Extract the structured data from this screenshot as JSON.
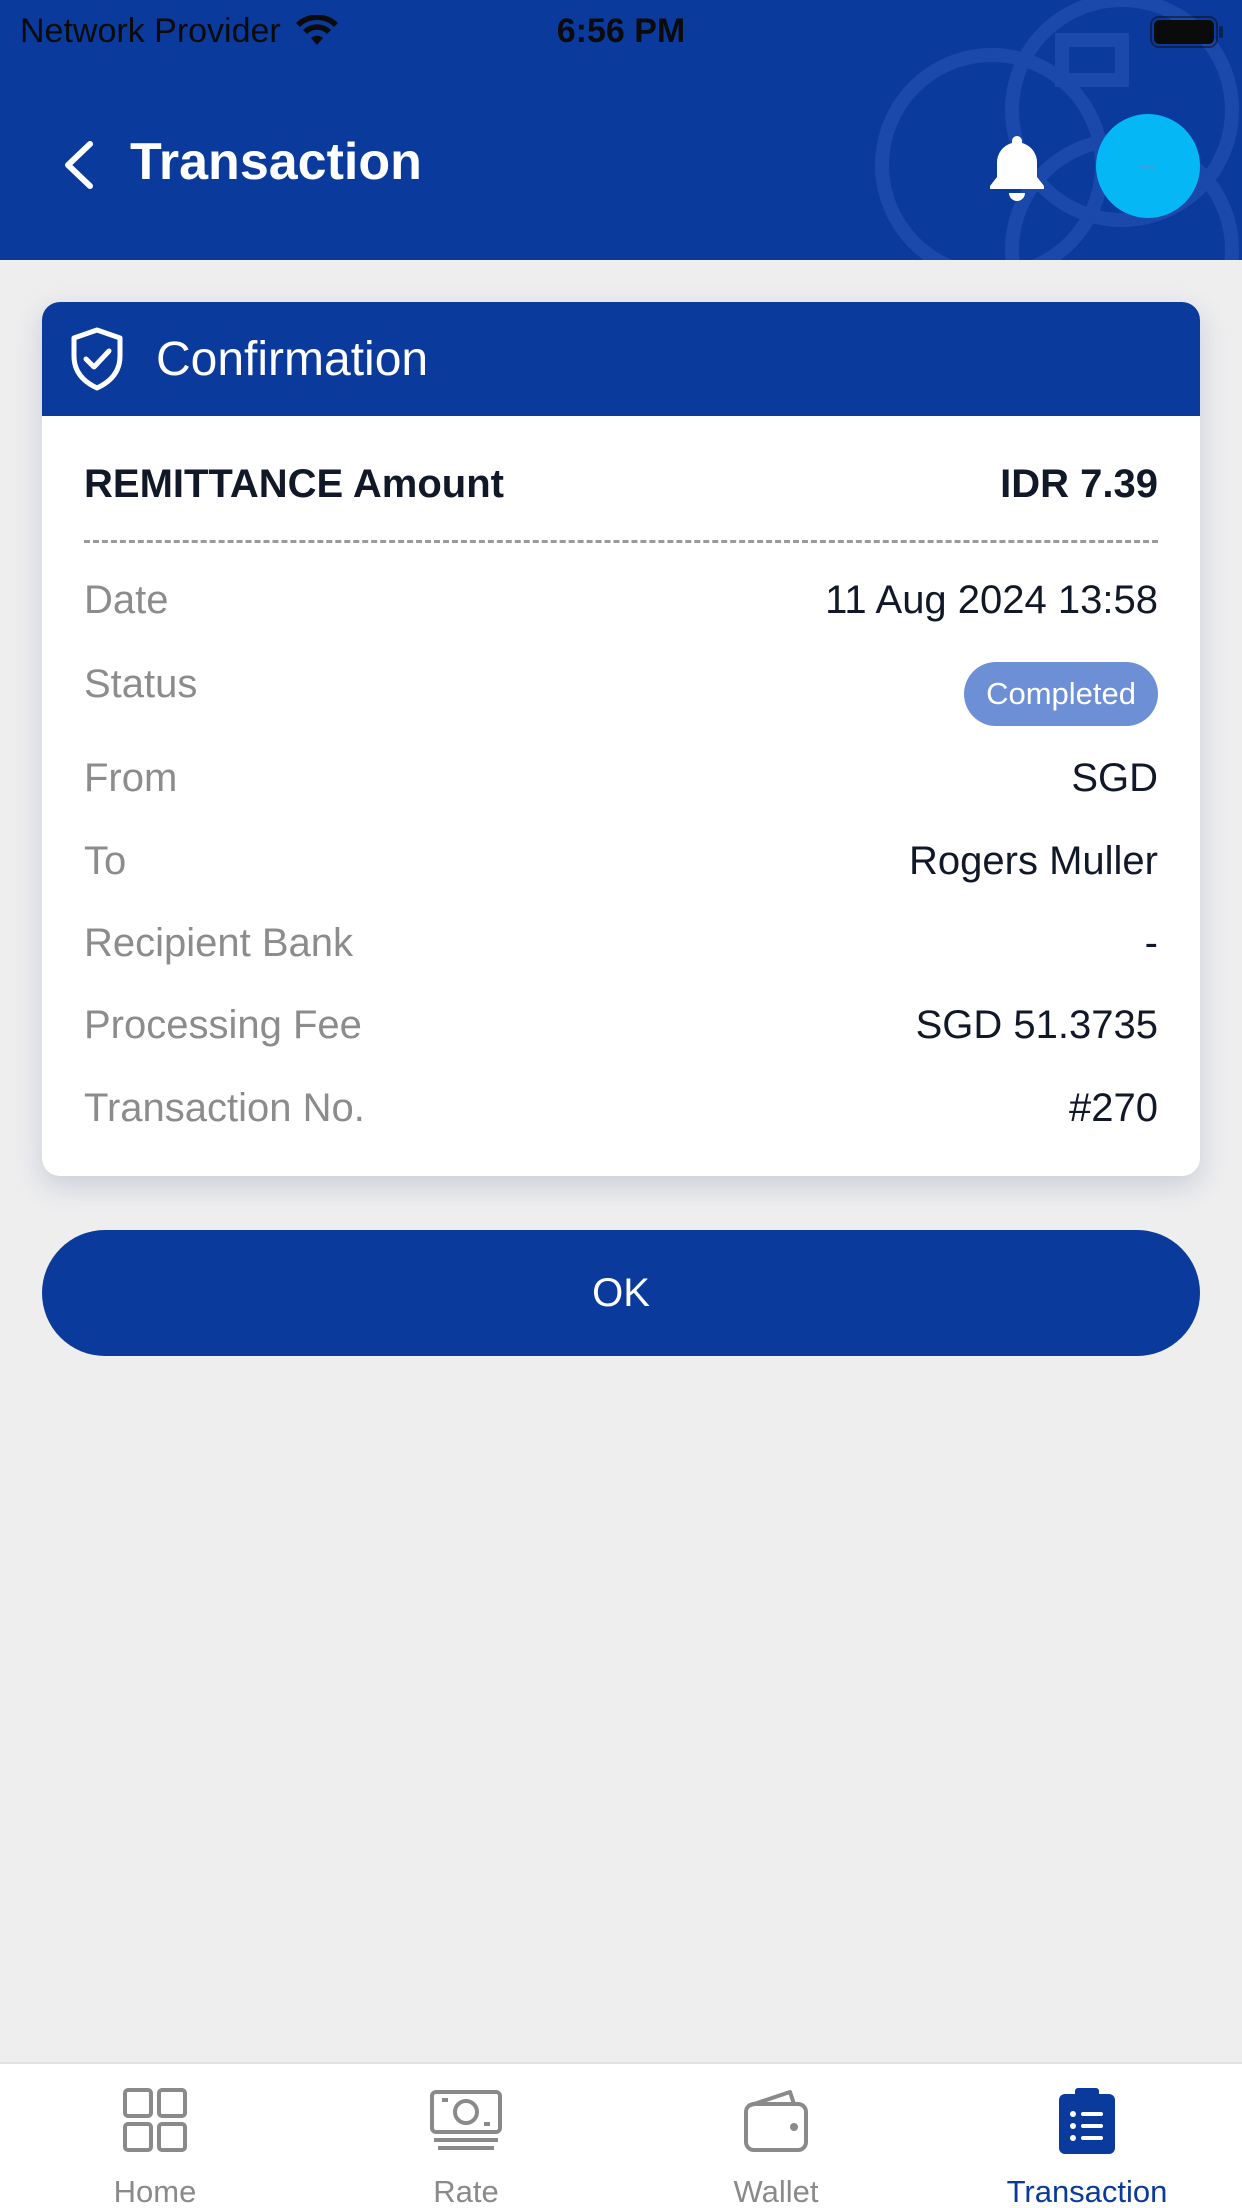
{
  "status_bar": {
    "provider": "Network Provider",
    "time": "6:56 PM"
  },
  "header": {
    "title": "Transaction",
    "back_icon": "chevron-left-icon",
    "bell_icon": "bell-icon",
    "avatar_text": "-"
  },
  "card": {
    "title": "Confirmation",
    "amount_label": "REMITTANCE Amount",
    "amount_value": "IDR 7.39",
    "rows": [
      {
        "label": "Date",
        "value": "11 Aug 2024 13:58"
      },
      {
        "label": "Status",
        "value": "Completed"
      },
      {
        "label": "From",
        "value": "SGD"
      },
      {
        "label": "To",
        "value": "Rogers Muller"
      },
      {
        "label": "Recipient Bank",
        "value": "-"
      },
      {
        "label": "Processing Fee",
        "value": "SGD 51.3735"
      },
      {
        "label": "Transaction No.",
        "value": "#270"
      }
    ]
  },
  "ok_button": {
    "label": "OK"
  },
  "tabs": [
    {
      "label": "Home",
      "icon": "grid-icon"
    },
    {
      "label": "Rate",
      "icon": "banknote-icon"
    },
    {
      "label": "Wallet",
      "icon": "wallet-icon"
    },
    {
      "label": "Transaction",
      "icon": "clipboard-list-icon",
      "active": true
    }
  ],
  "colors": {
    "primary": "#0a3a9c",
    "badge": "#6c8fd6",
    "avatar": "#05b7f5",
    "background": "#eeeeef"
  }
}
